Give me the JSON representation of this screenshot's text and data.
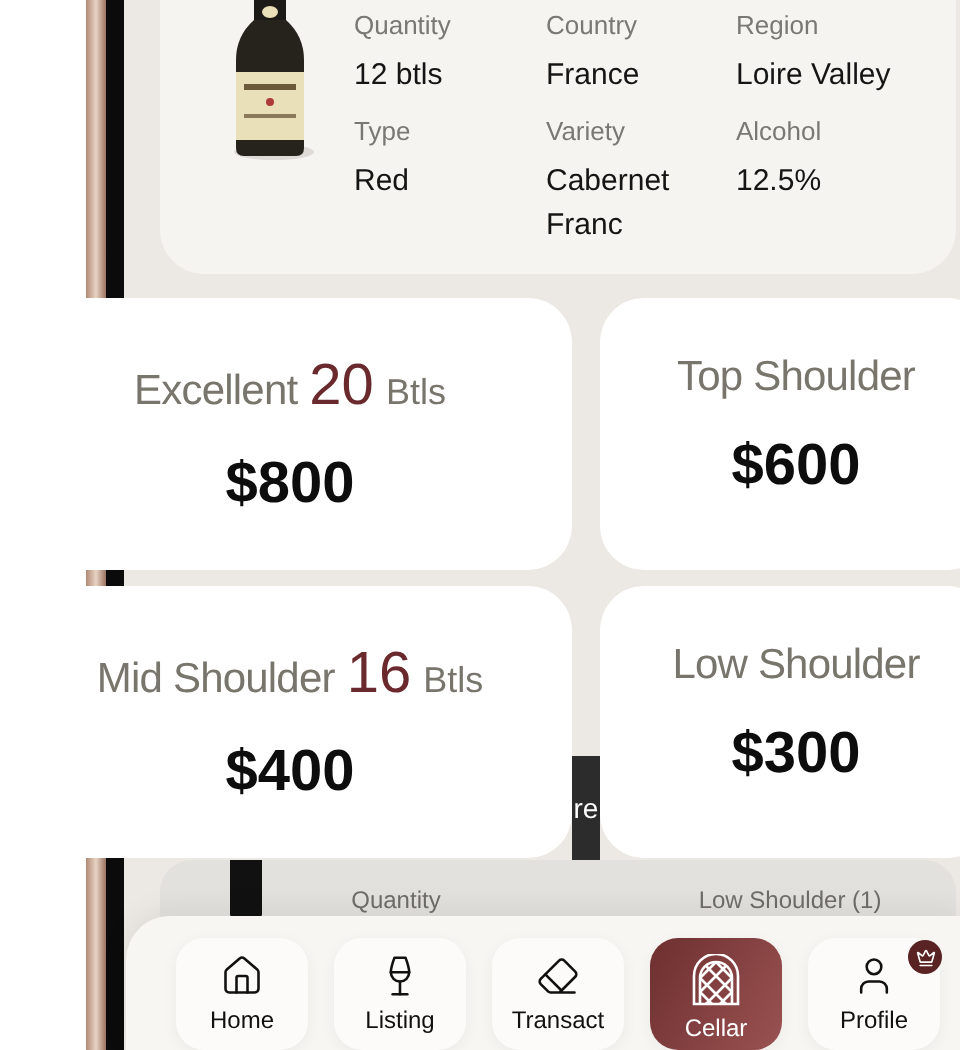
{
  "product": {
    "fields": [
      {
        "label": "Quantity",
        "value": "12 btls"
      },
      {
        "label": "Country",
        "value": "France"
      },
      {
        "label": "Region",
        "value": "Loire Valley"
      },
      {
        "label": "Type",
        "value": "Red"
      },
      {
        "label": "Variety",
        "value": "Cabernet Franc"
      },
      {
        "label": "Alcohol",
        "value": "12.5%"
      }
    ]
  },
  "behind_button": {
    "label": "re"
  },
  "lower_item": {
    "fields": [
      "Quantity",
      "Low Shoulder (1)"
    ]
  },
  "grade_cards": [
    {
      "grade": "Excellent",
      "count": "20",
      "unit": "Btls",
      "price": "$800"
    },
    {
      "grade": "Top Shoulder",
      "price": "$600"
    },
    {
      "grade": "Mid Shoulder",
      "count": "16",
      "unit": "Btls",
      "price": "$400"
    },
    {
      "grade": "Low Shoulder",
      "price": "$300"
    }
  ],
  "nav": [
    {
      "label": "Home",
      "kind": "home",
      "selected": false
    },
    {
      "label": "Listing",
      "kind": "glass",
      "selected": false
    },
    {
      "label": "Transact",
      "kind": "tag",
      "selected": false
    },
    {
      "label": "Cellar",
      "kind": "cellar",
      "selected": true
    },
    {
      "label": "Profile",
      "kind": "user",
      "selected": false,
      "badge": true
    }
  ]
}
